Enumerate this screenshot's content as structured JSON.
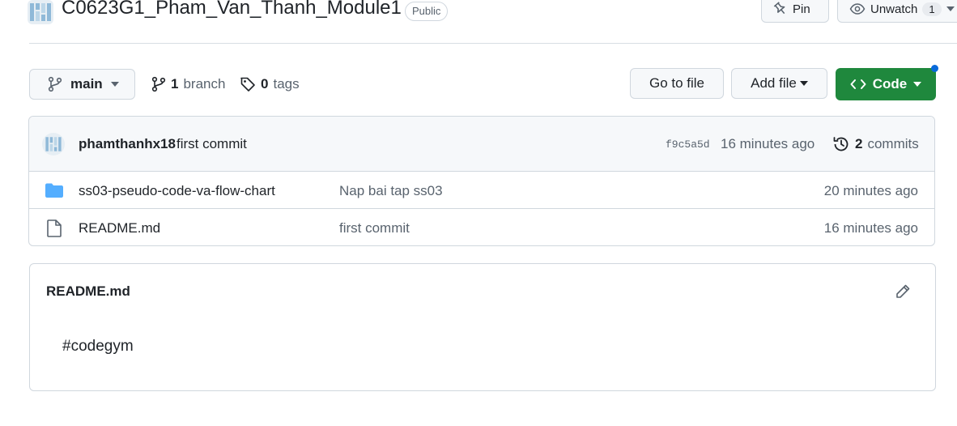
{
  "repo": {
    "title": "C0623G1_Pham_Van_Thanh_Module1",
    "visibility": "Public"
  },
  "header_actions": {
    "pin_label": "Pin",
    "watch_label": "Unwatch",
    "watch_count": "1"
  },
  "toolbar": {
    "branch_name": "main",
    "branch_count": "1",
    "branch_word": "branch",
    "tag_count": "0",
    "tag_word": "tags",
    "go_to_file": "Go to file",
    "add_file": "Add file",
    "code": "Code"
  },
  "latest_commit": {
    "author": "phamthanhx18",
    "message": "first commit",
    "sha": "f9c5a5d",
    "time": "16 minutes ago",
    "commit_count": "2",
    "commit_word": "commits"
  },
  "files": [
    {
      "icon": "folder-icon",
      "name": "ss03-pseudo-code-va-flow-chart",
      "message": "Nap bai tap ss03",
      "time": "20 minutes ago"
    },
    {
      "icon": "file-icon",
      "name": "README.md",
      "message": "first commit",
      "time": "16 minutes ago"
    }
  ],
  "readme": {
    "title": "README.md",
    "content": "#codegym"
  },
  "colors": {
    "accent_green": "#1f883d",
    "folder_blue": "#54aeff",
    "notification_blue": "#0969da"
  }
}
